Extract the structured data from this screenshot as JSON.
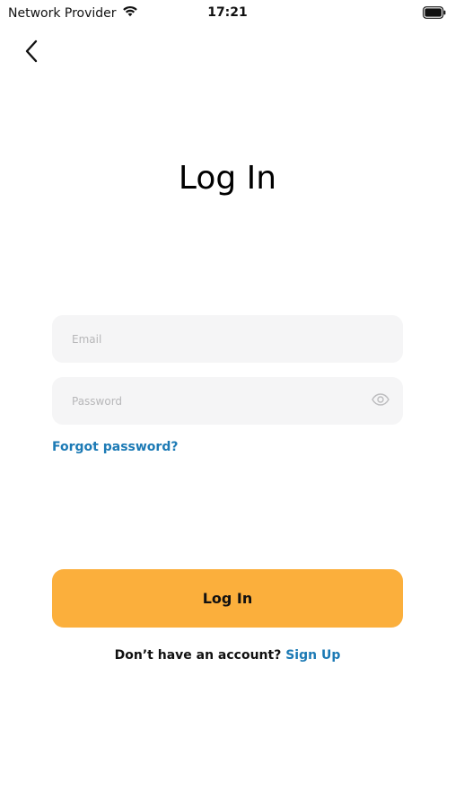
{
  "status_bar": {
    "carrier": "Network Provider",
    "time": "17:21",
    "icons": [
      "wifi-icon",
      "battery-icon"
    ]
  },
  "nav": {
    "back_icon": "chevron-left-icon"
  },
  "title": "Log In",
  "form": {
    "email_placeholder": "Email",
    "email_value": "",
    "password_placeholder": "Password",
    "password_value": "",
    "password_toggle_icon": "eye-icon"
  },
  "forgot_password_label": "Forgot password?",
  "login_button_label": "Log In",
  "signup": {
    "prompt": "Don’t have an account? ",
    "link_label": "Sign Up"
  },
  "colors": {
    "accent": "#fbaf3c",
    "link": "#1c7ab5",
    "field_bg": "#f5f5f6",
    "placeholder": "#b7b7b9"
  }
}
